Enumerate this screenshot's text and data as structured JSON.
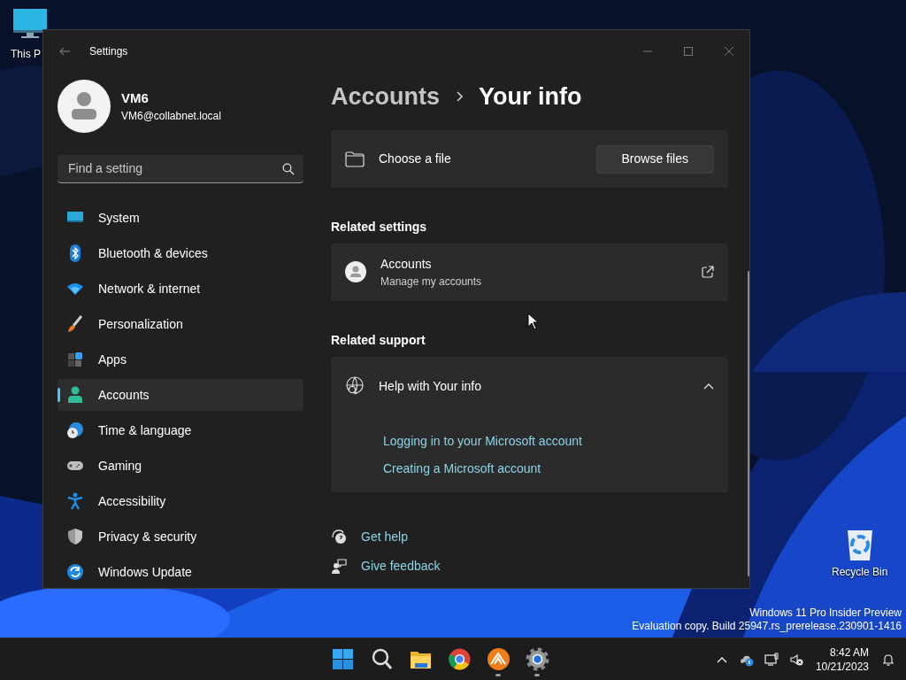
{
  "desktop": {
    "icons": [
      {
        "kind": "pc",
        "label": "This P"
      },
      {
        "kind": "recycle",
        "label": "Recycle Bin"
      }
    ],
    "watermark": [
      "Windows 11 Pro Insider Preview",
      "Evaluation copy. Build 25947.rs_prerelease.230901-1416"
    ]
  },
  "window": {
    "title": "Settings",
    "user": {
      "name": "VM6",
      "email": "VM6@collabnet.local"
    },
    "search": {
      "placeholder": "Find a setting"
    },
    "nav": [
      {
        "kind": "system",
        "label": "System",
        "selected": false
      },
      {
        "kind": "bluetooth",
        "label": "Bluetooth & devices",
        "selected": false
      },
      {
        "kind": "network",
        "label": "Network & internet",
        "selected": false
      },
      {
        "kind": "personalization",
        "label": "Personalization",
        "selected": false
      },
      {
        "kind": "apps",
        "label": "Apps",
        "selected": false
      },
      {
        "kind": "accounts",
        "label": "Accounts",
        "selected": true
      },
      {
        "kind": "time",
        "label": "Time & language",
        "selected": false
      },
      {
        "kind": "gaming",
        "label": "Gaming",
        "selected": false
      },
      {
        "kind": "accessibility",
        "label": "Accessibility",
        "selected": false
      },
      {
        "kind": "privacy",
        "label": "Privacy & security",
        "selected": false
      },
      {
        "kind": "update",
        "label": "Windows Update",
        "selected": false
      }
    ],
    "breadcrumb": {
      "parent": "Accounts",
      "current": "Your info"
    },
    "choose_file": {
      "label": "Choose a file",
      "button": "Browse files"
    },
    "related_settings": {
      "heading": "Related settings",
      "items": [
        {
          "title": "Accounts",
          "subtitle": "Manage my accounts"
        }
      ]
    },
    "related_support": {
      "heading": "Related support",
      "expander": {
        "title": "Help with Your info",
        "expanded": true,
        "links": [
          "Logging in to your Microsoft account",
          "Creating a Microsoft account"
        ]
      }
    },
    "footer_links": [
      {
        "kind": "help",
        "label": "Get help"
      },
      {
        "kind": "feedback",
        "label": "Give feedback"
      }
    ]
  },
  "taskbar": {
    "apps": [
      {
        "kind": "start",
        "running": false
      },
      {
        "kind": "search",
        "running": false
      },
      {
        "kind": "explorer",
        "running": false
      },
      {
        "kind": "browser",
        "running": false
      },
      {
        "kind": "app",
        "running": true
      },
      {
        "kind": "settings",
        "running": true
      }
    ],
    "tray": {
      "time": "8:42 AM",
      "date": "10/21/2023"
    }
  }
}
